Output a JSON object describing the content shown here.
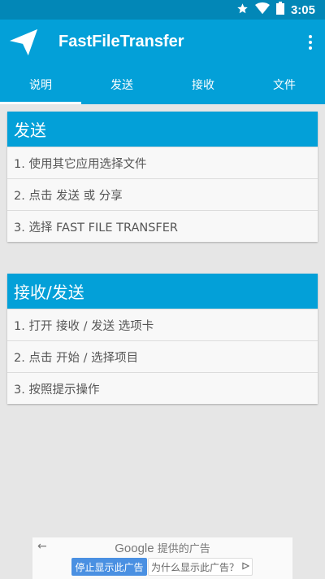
{
  "status": {
    "time": "3:05",
    "star_icon": "star-icon",
    "wifi_icon": "wifi-icon",
    "battery_icon": "battery-icon"
  },
  "appbar": {
    "title": "FastFileTransfer",
    "logo_icon": "paper-plane-icon",
    "menu_icon": "more-vert-icon"
  },
  "tabs": [
    {
      "label": "说明",
      "active": true
    },
    {
      "label": "发送",
      "active": false
    },
    {
      "label": "接收",
      "active": false
    },
    {
      "label": "文件",
      "active": false
    }
  ],
  "cards": [
    {
      "header": "发送",
      "rows": [
        "1. 使用其它应用选择文件",
        "2. 点击 发送 或 分享",
        "3. 选择 FAST FILE TRANSFER"
      ]
    },
    {
      "header": "接收/发送",
      "rows": [
        "1. 打开 接收 / 发送 选项卡",
        "2. 点击 开始 / 选择项目",
        "3. 按照提示操作"
      ]
    }
  ],
  "ad": {
    "back": "←",
    "brand": "Google",
    "provided": "提供的广告",
    "stop_label": "停止显示此广告",
    "why_label": "为什么显示此广告？",
    "why_icon": "ad-choices-icon"
  },
  "colors": {
    "primary": "#03a0d8",
    "status": "#0287b7",
    "background": "#e6e6e6"
  }
}
